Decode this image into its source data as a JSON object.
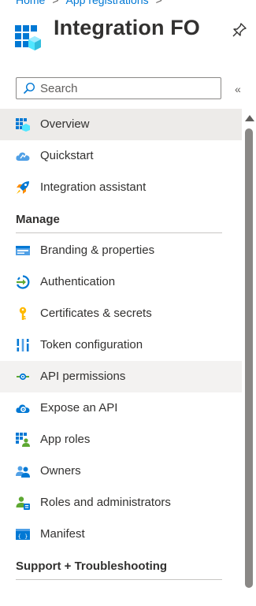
{
  "breadcrumb": {
    "home": "Home",
    "separator": ">",
    "current": "App registrations"
  },
  "header": {
    "title": "Integration FO",
    "app_icon": "app-registration-icon",
    "pin_icon": "pin-icon"
  },
  "search": {
    "placeholder": "Search",
    "value": "",
    "collapse_glyph": "«"
  },
  "nav": {
    "top_items": [
      {
        "label": "Overview",
        "icon": "overview-icon",
        "state": "selected"
      },
      {
        "label": "Quickstart",
        "icon": "quickstart-cloud-icon"
      },
      {
        "label": "Integration assistant",
        "icon": "rocket-icon"
      }
    ],
    "manage_header": "Manage",
    "manage_items": [
      {
        "label": "Branding & properties",
        "icon": "branding-icon"
      },
      {
        "label": "Authentication",
        "icon": "authentication-icon"
      },
      {
        "label": "Certificates & secrets",
        "icon": "key-icon"
      },
      {
        "label": "Token configuration",
        "icon": "token-bars-icon"
      },
      {
        "label": "API permissions",
        "icon": "api-permissions-icon",
        "state": "hover"
      },
      {
        "label": "Expose an API",
        "icon": "cloud-gear-icon"
      },
      {
        "label": "App roles",
        "icon": "app-roles-icon"
      },
      {
        "label": "Owners",
        "icon": "owners-icon"
      },
      {
        "label": "Roles and administrators",
        "icon": "roles-admin-icon"
      },
      {
        "label": "Manifest",
        "icon": "manifest-icon"
      }
    ],
    "support_header": "Support + Troubleshooting"
  },
  "colors": {
    "accent": "#0078d4",
    "selected_bg": "#edebe9",
    "hover_bg": "#f3f2f1",
    "text": "#323130"
  }
}
